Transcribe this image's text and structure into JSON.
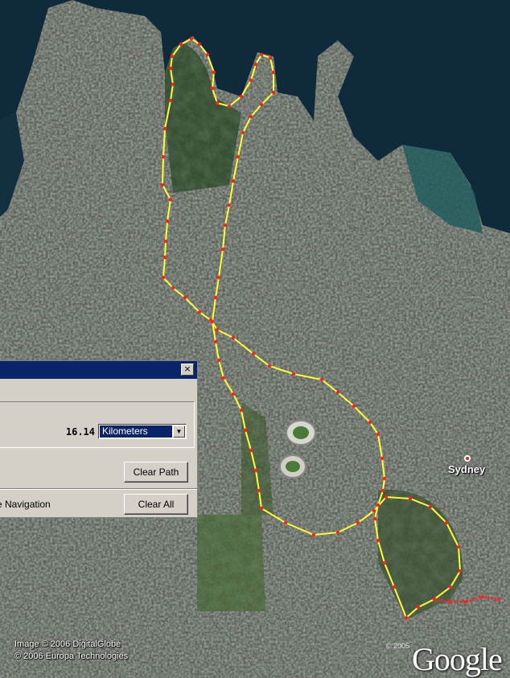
{
  "map": {
    "place_label": "Sydney",
    "copyright_lines": [
      "Image © 2006 DigitalGlobe",
      "© 2006 Europa Technologies"
    ],
    "small_copyright": "© 2005",
    "logo_text": "Google",
    "path_color": "#ffff33",
    "point_color": "#ff2020",
    "water_color": "#0f2a3a",
    "land_color": "#3a4a3a"
  },
  "dialog": {
    "distance_value": "16.14",
    "unit_selected": "Kilometers",
    "clear_path_label": "Clear Path",
    "navigation_label": "e Navigation",
    "clear_all_label": "Clear All",
    "close_glyph": "×"
  }
}
